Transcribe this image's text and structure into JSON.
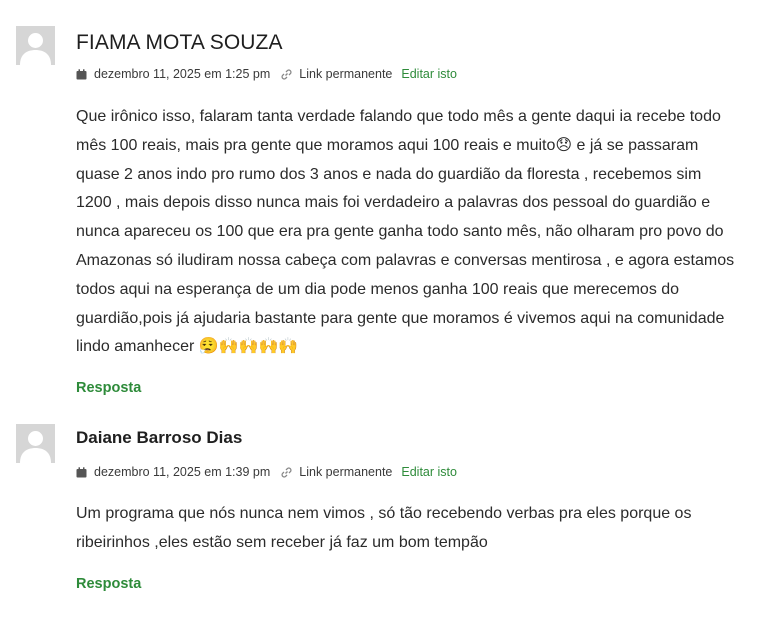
{
  "comments": [
    {
      "author": "FIAMA MOTA SOUZA",
      "date": "dezembro 11, 2025 em 1:25 pm",
      "permalink": "Link permanente",
      "edit": "Editar isto",
      "text": "Que irônico isso, falaram tanta verdade falando que todo mês a gente daqui ia recebe todo mês 100 reais, mais pra gente que moramos aqui 100 reais e muito😞 e já se passaram quase 2 anos indo pro rumo dos 3 anos e nada do guardião da floresta , recebemos sim 1200 , mais depois disso nunca mais foi verdadeiro a palavras dos pessoal do guardião e nunca apareceu os 100 que era pra gente ganha todo santo mês, não olharam pro povo do Amazonas só iludiram nossa cabeça com palavras e conversas mentirosa , e agora estamos todos aqui na esperança de um dia pode menos ganha 100 reais que merecemos do guardião,pois já ajudaria bastante para gente que moramos é vivemos aqui na comunidade lindo amanhecer 😮‍💨🙌🙌🙌🙌",
      "reply": "Resposta"
    },
    {
      "author": "Daiane Barroso Dias",
      "date": "dezembro 11, 2025 em 1:39 pm",
      "permalink": "Link permanente",
      "edit": "Editar isto",
      "text": "Um programa que nós nunca nem vimos , só tão recebendo verbas pra eles porque os ribeirinhos ,eles estão sem receber já faz um bom tempão",
      "reply": "Resposta"
    }
  ],
  "colors": {
    "link_green": "#2e8b3a",
    "text": "#2b2b2b",
    "meta": "#3a3a3a",
    "avatar_bg": "#d6d6d6"
  },
  "icons": {
    "date": "calendar-icon",
    "permalink": "link-icon",
    "avatar": "default-avatar-silhouette"
  }
}
